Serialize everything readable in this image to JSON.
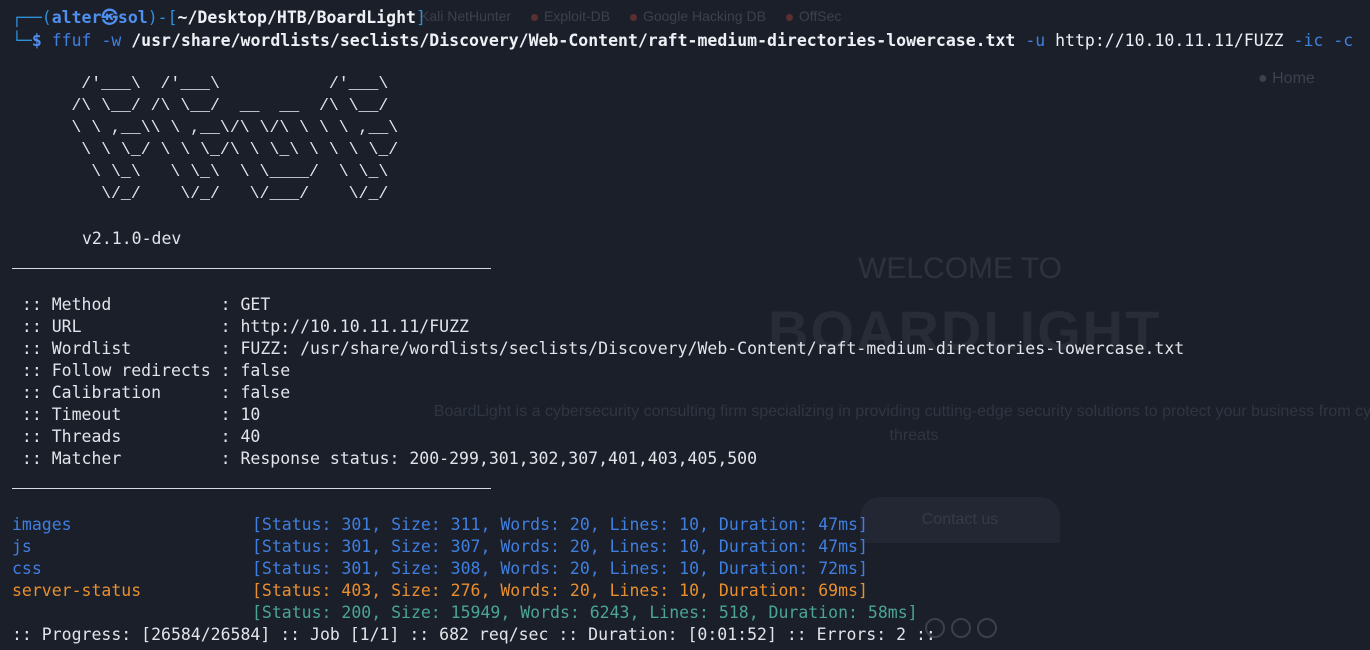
{
  "background_page": {
    "tabs": [
      "Kali NetHunter",
      "Exploit-DB",
      "Google Hacking DB",
      "OffSec"
    ],
    "nav_home": "● Home",
    "welcome": "WELCOME TO",
    "brand": "BOARDLIGHT",
    "tagline": "BoardLight is a cybersecurity consulting firm specializing in providing cutting-edge security solutions to protect your business from cyber threats",
    "contact_button": "Contact us"
  },
  "prompt": {
    "corner_top": "┌──(",
    "user": "alter",
    "at": "㉿",
    "host": "sol",
    "mid": ")-[",
    "path": "~/Desktop/HTB/BoardLight",
    "end": "]",
    "corner_bottom": "└─",
    "symbol": "$",
    "cmd_name": "ffuf",
    "flag_w": "-w",
    "wordlist": "/usr/share/wordlists/seclists/Discovery/Web-Content/raft-medium-directories-lowercase.txt",
    "flag_u": "-u",
    "url": "http://10.10.11.11/FUZZ",
    "flag_ic": "-ic",
    "flag_c": "-c"
  },
  "banner": {
    "ascii_art": "       /'___\\  /'___\\           /'___\\\n      /\\ \\__/ /\\ \\__/  __  __  /\\ \\__/\n      \\ \\ ,__\\\\ \\ ,__\\/\\ \\/\\ \\ \\ \\ ,__\\\n       \\ \\ \\_/ \\ \\ \\_/\\ \\ \\_\\ \\ \\ \\ \\_/\n        \\ \\_\\   \\ \\_\\  \\ \\____/  \\ \\_\\\n         \\/_/    \\/_/   \\/___/    \\/_/",
    "version": "v2.1.0-dev"
  },
  "config": [
    {
      "key": " :: Method           ",
      "value": ": GET"
    },
    {
      "key": " :: URL              ",
      "value": ": http://10.10.11.11/FUZZ"
    },
    {
      "key": " :: Wordlist         ",
      "value": ": FUZZ: /usr/share/wordlists/seclists/Discovery/Web-Content/raft-medium-directories-lowercase.txt"
    },
    {
      "key": " :: Follow redirects ",
      "value": ": false"
    },
    {
      "key": " :: Calibration      ",
      "value": ": false"
    },
    {
      "key": " :: Timeout          ",
      "value": ": 10"
    },
    {
      "key": " :: Threads          ",
      "value": ": 40"
    },
    {
      "key": " :: Matcher          ",
      "value": ": Response status: 200-299,301,302,307,401,403,405,500"
    }
  ],
  "results": [
    {
      "name": "images",
      "info": "[Status: 301, Size: 311, Words: 20, Lines: 10, Duration: 47ms]",
      "color": "#3f7fe0"
    },
    {
      "name": "js",
      "info": "[Status: 301, Size: 307, Words: 20, Lines: 10, Duration: 47ms]",
      "color": "#3f7fe0"
    },
    {
      "name": "css",
      "info": "[Status: 301, Size: 308, Words: 20, Lines: 10, Duration: 72ms]",
      "color": "#3f7fe0"
    },
    {
      "name": "server-status",
      "info": "[Status: 403, Size: 276, Words: 20, Lines: 10, Duration: 69ms]",
      "color": "#e98f2e"
    },
    {
      "name": "",
      "info": "[Status: 200, Size: 15949, Words: 6243, Lines: 518, Duration: 58ms]",
      "color": "#4aa596"
    }
  ],
  "progress": ":: Progress: [26584/26584] :: Job [1/1] :: 682 req/sec :: Duration: [0:01:52] :: Errors: 2 ::"
}
